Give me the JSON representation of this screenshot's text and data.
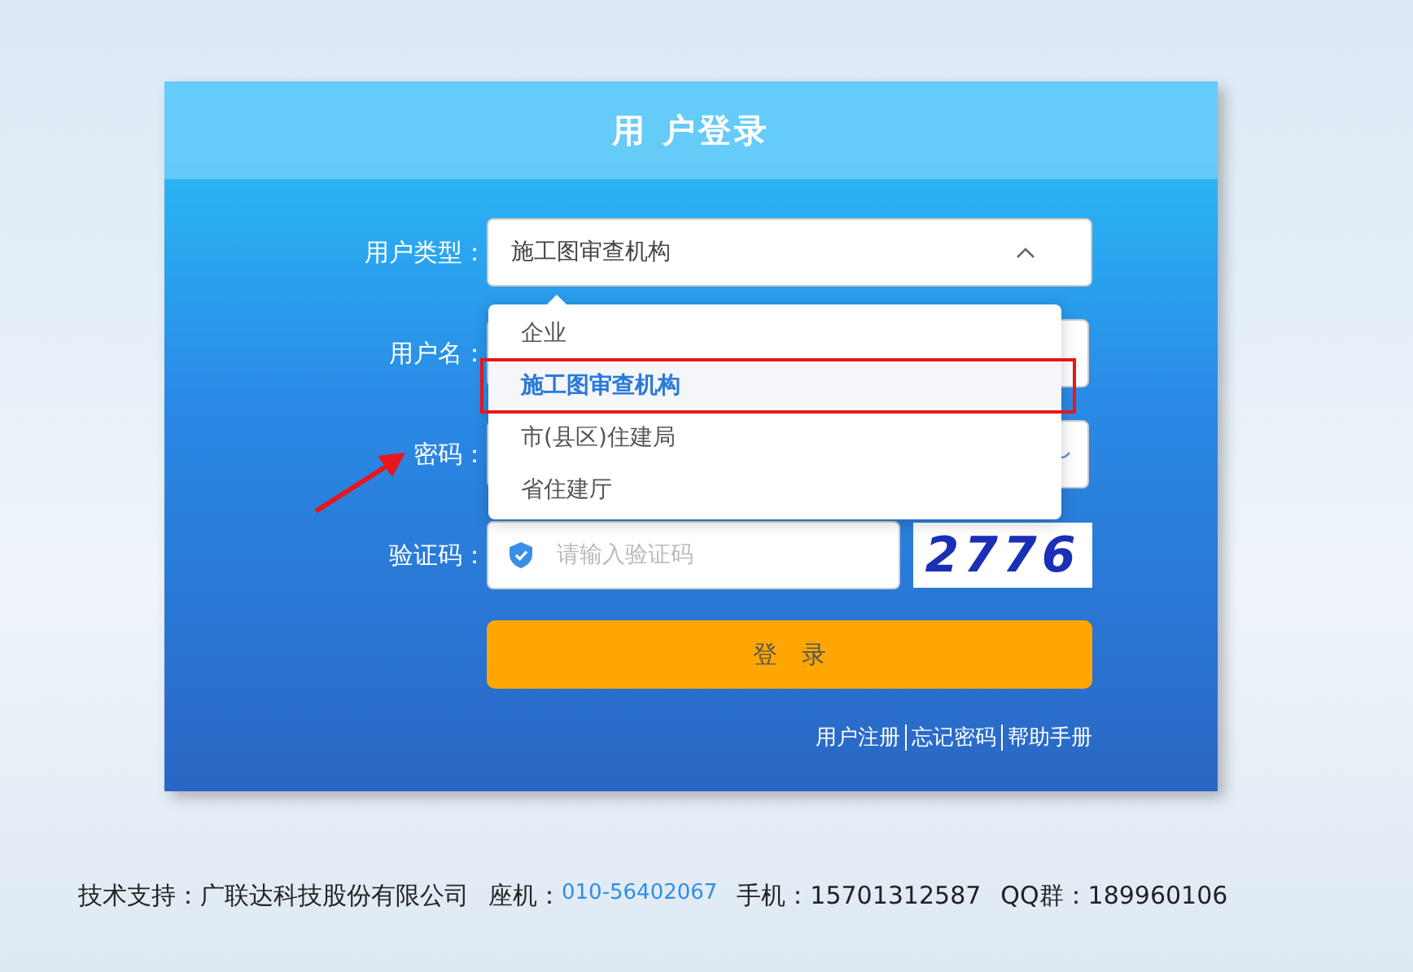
{
  "title": "用 户登录",
  "fields": [
    {
      "kind": "select",
      "label": "用户类型：",
      "value": "施工图审查机构",
      "expanded": true
    },
    {
      "kind": "text",
      "label": "用户名："
    },
    {
      "kind": "password",
      "label": "密码："
    },
    {
      "kind": "captcha",
      "label": "验证码：",
      "placeholder": "请输入验证码",
      "captcha": "2776"
    }
  ],
  "dropdown": [
    {
      "label": "企业",
      "selected": false
    },
    {
      "label": "施工图审查机构",
      "selected": true
    },
    {
      "label": "市(县区)住建局",
      "selected": false
    },
    {
      "label": "省住建厅",
      "selected": false
    }
  ],
  "login_button": "登　录",
  "links": [
    "用户注册",
    "忘记密码",
    "帮助手册"
  ],
  "footer": [
    {
      "label": "技术支持：广联达科技股份有限公司",
      "kind": "text"
    },
    {
      "label": "座机：",
      "kind": "text"
    },
    {
      "label": "010-56402067",
      "kind": "link"
    },
    {
      "label": "手机：15701312587",
      "kind": "text"
    },
    {
      "label": "QQ群：189960106",
      "kind": "text"
    }
  ]
}
